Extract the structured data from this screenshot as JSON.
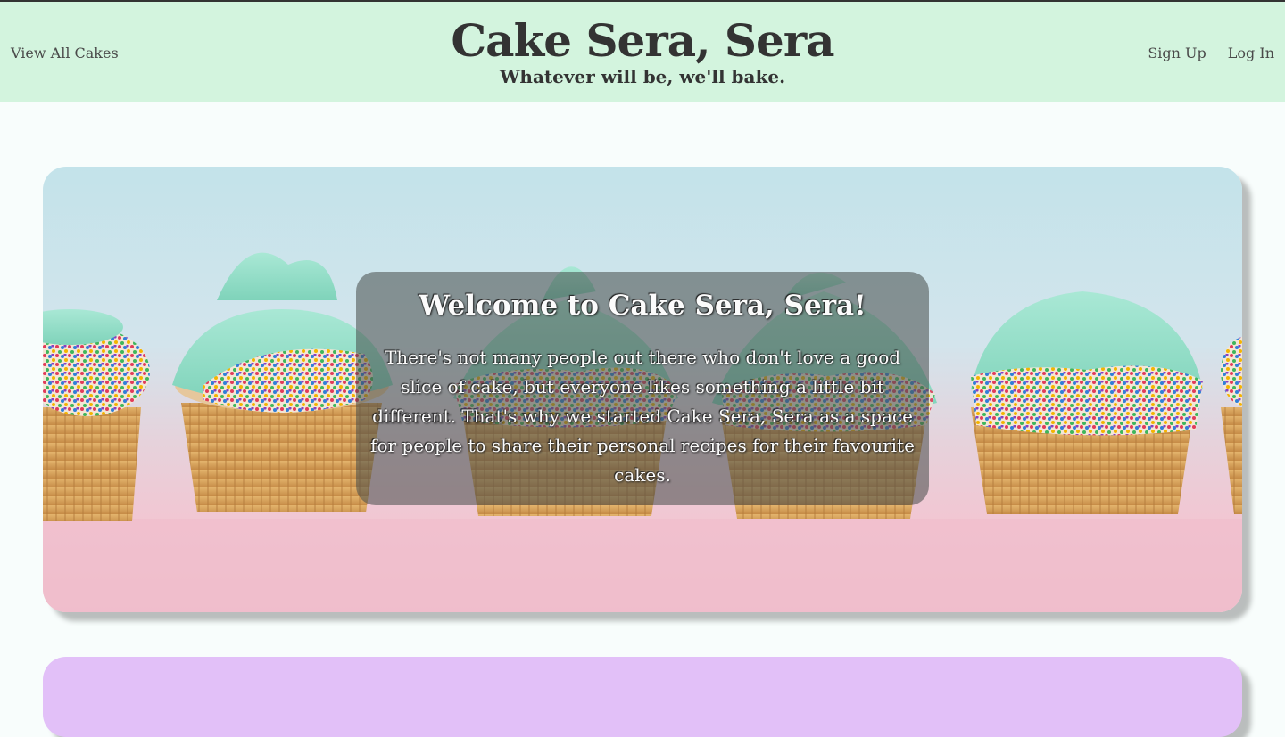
{
  "header": {
    "nav_left": "View All Cakes",
    "title": "Cake Sera, Sera",
    "tagline": "Whatever will be, we'll bake.",
    "nav_right": [
      "Sign Up",
      "Log In"
    ]
  },
  "hero": {
    "heading": "Welcome to Cake Sera, Sera!",
    "body": "There's not many people out there who don't love a good slice of cake, but everyone likes something a little bit different. That's why we started Cake Sera, Sera as a space for people to share their personal recipes for their favourite cakes.",
    "image_subject": "cupcakes-with-mint-frosting-and-sprinkles"
  },
  "colors": {
    "header_bg": "#d3f4de",
    "page_bg": "#f8fdfc",
    "second_panel_bg": "#e2c0f8",
    "frosting": "#8fdcc4",
    "wrapper": "#d9a45e"
  }
}
